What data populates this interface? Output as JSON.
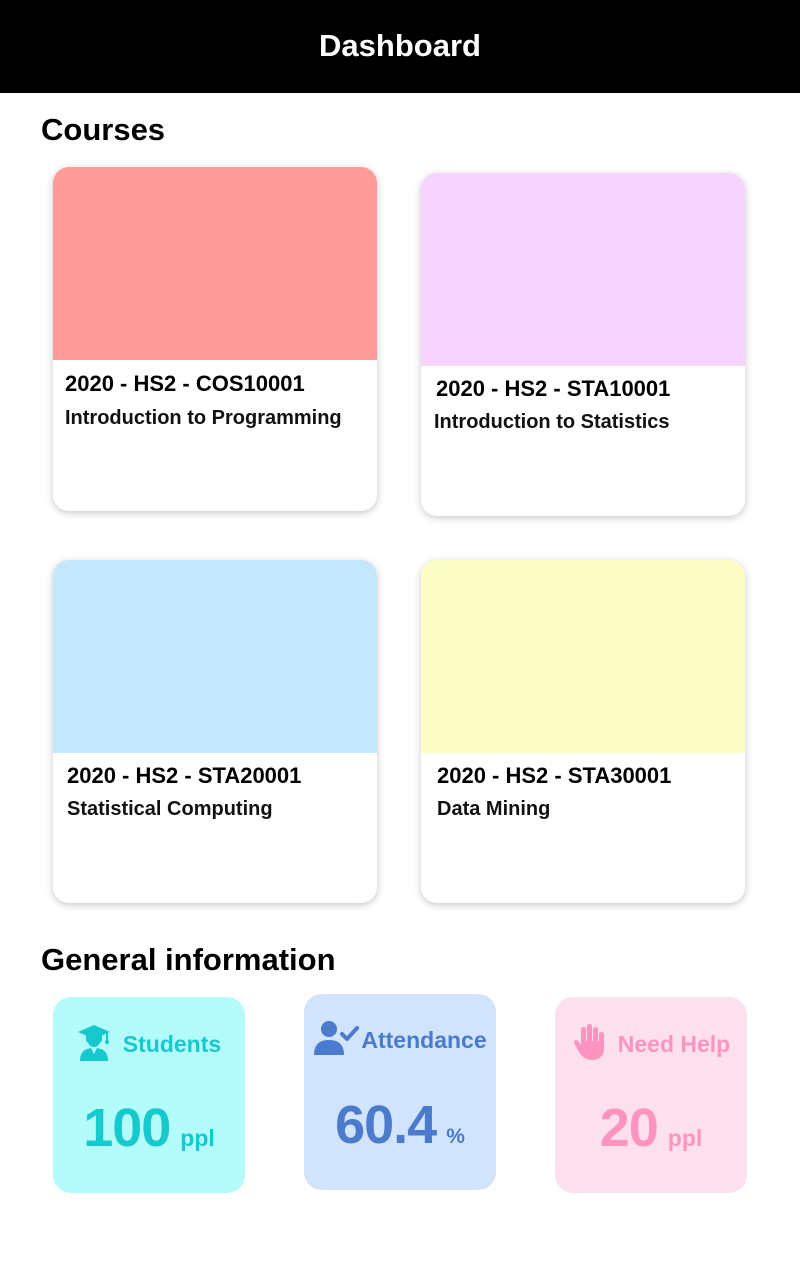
{
  "header": {
    "title": "Dashboard"
  },
  "courses_section": {
    "title": "Courses",
    "items": [
      {
        "code": "2020 - HS2 - COS10001",
        "name": "Introduction to Programming",
        "color": "#ff9b99"
      },
      {
        "code": "2020 - HS2 - STA10001",
        "name": "Introduction to Statistics",
        "color": "#f7d4fd"
      },
      {
        "code": "2020 - HS2 - STA20001",
        "name": "Statistical Computing",
        "color": "#c5e7fd"
      },
      {
        "code": "2020 - HS2 - STA30001",
        "name": "Data Mining",
        "color": "#fdfec5"
      }
    ]
  },
  "general_section": {
    "title": "General information",
    "cards": [
      {
        "label": "Students",
        "value": "100",
        "unit": "ppl",
        "icon": "graduate-icon",
        "bg": "#b4fbfc",
        "color": "#15c9cd"
      },
      {
        "label": "Attendance",
        "value": "60.4",
        "unit": "%",
        "icon": "user-check-icon",
        "bg": "#d2e3fc",
        "color": "#4a7bcc"
      },
      {
        "label": "Need Help",
        "value": "20",
        "unit": "ppl",
        "icon": "raised-hand-icon",
        "bg": "#fde0ee",
        "color": "#fd93bf"
      }
    ]
  }
}
